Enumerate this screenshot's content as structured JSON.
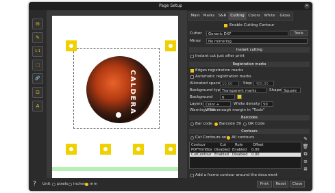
{
  "window": {
    "title": "Page Setup",
    "close": "✕"
  },
  "tools": [
    "⊟",
    "✎",
    "1:1",
    "⬚",
    "🔗",
    "⊡",
    "A"
  ],
  "tabs": [
    "Main",
    "Marks",
    "S&R",
    "Cutting",
    "Colors",
    "White",
    "Gloss"
  ],
  "tabs_active": "Cutting",
  "cutting": {
    "enable_label": "Enable Cutting Contour",
    "cutter_label": "Cutter",
    "cutter_value": "Generic DXF",
    "tools_btn": "Tools",
    "mirror_label": "Mirror",
    "mirror_value": "No mirroring",
    "instant_section": "Instant cutting",
    "instant_label": "Instant cut just after print",
    "reg_section": "Registration marks",
    "edges_label": "Edges registration marks",
    "auto_label": "Automatic registration marks",
    "alloc_label": "Allocated space",
    "alloc_value": "10.00",
    "step_label": "Step",
    "step_value": "400.00",
    "bgtype_label": "Background type",
    "bgtype_value": "Transparent marks",
    "shape_label": "Shape",
    "shape_value": "Square",
    "background_label": "Background",
    "background_value": "6",
    "layers_label": "Layers",
    "layers_value": "Color + White",
    "white_density_label": "White density",
    "white_density_value": "50",
    "warning": "Warning : Set enough margin in \"Tools\"",
    "barcodes_section": "Barcodes",
    "barcode_options": [
      "Bar code",
      "Barcode 39",
      "QR Code"
    ],
    "barcode_selected": "Barcode 39",
    "contours_section": "Contours",
    "contour_options": [
      "Cut Contours only",
      "All contours"
    ],
    "contour_selected": "All contours",
    "table_headers": [
      "Contour",
      "Cut",
      "Rule",
      "Offset"
    ],
    "table_rows": [
      [
        "PDFTrimBox",
        "Disabled",
        "Enabled",
        "0.00"
      ],
      [
        "CutContour",
        "Enabled",
        "Disabled",
        "0.00"
      ]
    ],
    "frame_label": "Add a frame contour around the document"
  },
  "bottom": {
    "help": "?",
    "unit_label": "Unit",
    "units": [
      "pixels",
      "inches",
      "mm"
    ],
    "unit_selected": "mm",
    "print": "Print",
    "reset": "Reset",
    "close": "Close"
  },
  "preview": {
    "disc_text": "CALDERA"
  },
  "colors": {
    "accent": "#f0c419",
    "mark": "#f0d000",
    "panel": "#2d2d2d"
  }
}
